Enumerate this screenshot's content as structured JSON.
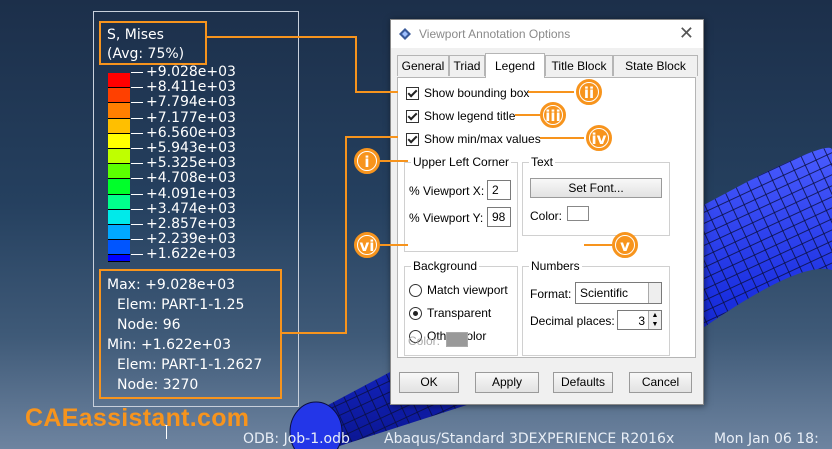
{
  "legend": {
    "title_line1": "S, Mises",
    "title_line2": "(Avg: 75%)",
    "values": [
      "+9.028e+03",
      "+8.411e+03",
      "+7.794e+03",
      "+7.177e+03",
      "+6.560e+03",
      "+5.943e+03",
      "+5.325e+03",
      "+4.708e+03",
      "+4.091e+03",
      "+3.474e+03",
      "+2.857e+03",
      "+2.239e+03",
      "+1.622e+03"
    ],
    "colors": [
      "#ff0000",
      "#ff4000",
      "#ff7f00",
      "#ffbf00",
      "#ffff00",
      "#bfff00",
      "#5cff00",
      "#00ff2a",
      "#00ff8c",
      "#00eaea",
      "#00a8ff",
      "#0055ff",
      "#0000ff"
    ],
    "max_line": "Max: +9.028e+03",
    "max_elem": "Elem: PART-1-1.25",
    "max_node": "Node: 96",
    "min_line": "Min: +1.622e+03",
    "min_elem": "Elem: PART-1-1.2627",
    "min_node": "Node: 3270"
  },
  "brand": "CAEassistant.com",
  "status_bar": {
    "odb": "ODB: Job-1.odb",
    "solver": "Abaqus/Standard 3DEXPERIENCE R2016x",
    "date": "Mon Jan 06 18:"
  },
  "dialog": {
    "title": "Viewport Annotation Options",
    "tabs": [
      "General",
      "Triad",
      "Legend",
      "Title Block",
      "State Block"
    ],
    "active_tab": "Legend",
    "show_bounding_box": "Show bounding box",
    "show_legend_title": "Show legend title",
    "show_min_max": "Show min/max values",
    "upper_left_corner": "Upper Left Corner",
    "viewport_x_label": "% Viewport X:",
    "viewport_x_value": "2",
    "viewport_y_label": "% Viewport Y:",
    "viewport_y_value": "98",
    "text_group": "Text",
    "set_font": "Set Font...",
    "color_label": "Color:",
    "background_group": "Background",
    "bg_match": "Match viewport",
    "bg_transparent": "Transparent",
    "bg_other": "Other color",
    "bg_selected": "Transparent",
    "bg_color_label": "Color:",
    "numbers_group": "Numbers",
    "format_label": "Format:",
    "format_value": "Scientific",
    "decimal_label": "Decimal places:",
    "decimal_value": "3",
    "ok": "OK",
    "apply": "Apply",
    "defaults": "Defaults",
    "cancel": "Cancel"
  },
  "annotations": {
    "i": "i",
    "ii": "ii",
    "iii": "iii",
    "iv": "iv",
    "v": "v",
    "vi": "vi",
    "color": "#f7941d"
  },
  "theme": {
    "accent": "#f7941d",
    "mesh": "#1a2fe0"
  }
}
